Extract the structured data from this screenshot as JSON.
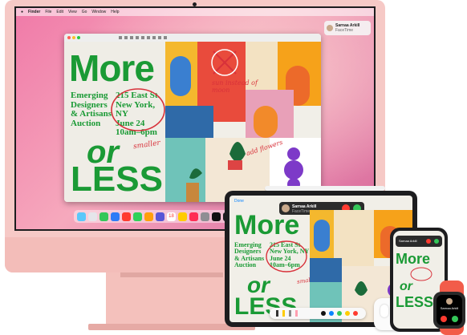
{
  "imac": {
    "menubar": {
      "items": [
        "Finder",
        "File",
        "Edit",
        "View",
        "Go",
        "Window",
        "Help"
      ]
    },
    "notification": {
      "title": "Sarnaa Arkill",
      "subtitle": "FaceTime"
    },
    "poster": {
      "line1": "More",
      "info": [
        "Emerging",
        "Designers",
        "& Artisans",
        "Auction"
      ],
      "address": [
        "215 East St.",
        "New York, NY",
        "June 24",
        "10am–6pm"
      ],
      "line2": "or",
      "line3": "LESS",
      "annotations": {
        "sun": "sun instead of moon",
        "flowers": "add flowers",
        "smaller": "smaller"
      }
    },
    "dock": {
      "icon_colors": [
        "#5ac8fa",
        "#ffffff",
        "#34c759",
        "#2f7cf6",
        "#ff3b30",
        "#30d158",
        "#ff9f0a",
        "#5856d6",
        "#ffcc00",
        "#ff2d55",
        "#8e8e93",
        "#111111",
        "#1c1c1e",
        "#0a84ff",
        "#af52de",
        "#e5e5ea",
        "#a2845e",
        "#98989d"
      ],
      "calendar_day": "18"
    }
  },
  "ipad": {
    "call_banner": {
      "name": "Sarnaa Arkill",
      "status": "FaceTime"
    },
    "top_left": "Done",
    "poster": {
      "line1": "More",
      "info": [
        "Emerging",
        "Designers",
        "& Artisans",
        "Auction"
      ],
      "address": [
        "215 East St.",
        "New York, NY",
        "June 24",
        "10am–6pm"
      ],
      "line2": "or",
      "line3": "LESS",
      "annotation": "smaller"
    }
  },
  "iphone": {
    "caller": "Sarnaa Arkill",
    "poster_lines": [
      "More",
      "or",
      "LESS"
    ]
  },
  "watch": {
    "caller": "Sarnaa Arkill"
  }
}
